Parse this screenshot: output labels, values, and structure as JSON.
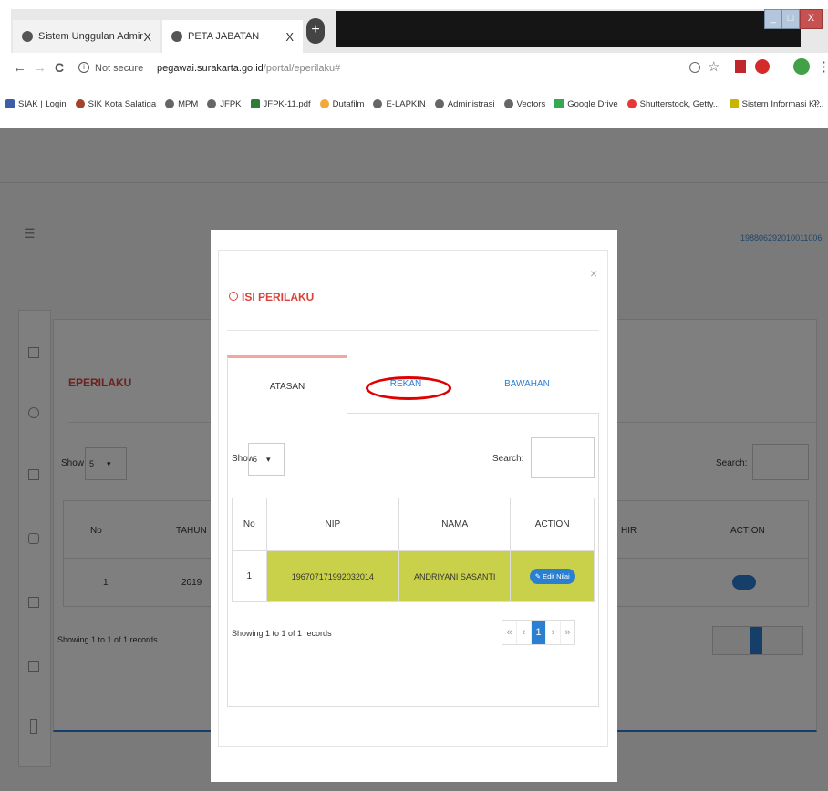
{
  "browser": {
    "tabs": [
      {
        "title": "Sistem Unggulan Administrasi Ke",
        "close": "X"
      },
      {
        "title": "PETA JABATAN",
        "close": "X"
      }
    ],
    "new_tab": "+",
    "window_buttons": [
      "_",
      "□",
      "X"
    ],
    "nav": {
      "back": "←",
      "forward": "→",
      "reload": "C"
    },
    "security": "Not secure",
    "url_host": "pegawai.surakarta.go.id",
    "url_path": "/portal/eperilaku#",
    "bookmarks": [
      "SIAK | Login",
      "SIK Kota Salatiga",
      "MPM",
      "JFPK",
      "JFPK-11.pdf",
      "Dutafilm",
      "E-LAPKIN",
      "Administrasi",
      "Vectors",
      "Google Drive",
      "Shutterstock, Getty...",
      "Sistem Informasi Ki..."
    ],
    "more_bookmarks": "»"
  },
  "page": {
    "user_nip": "198806292010011006",
    "section_title": "EPERILAKU",
    "show_label": "Show",
    "show_value": "5",
    "search_label": "Search:",
    "columns": [
      "No",
      "TAHUN",
      "HIR",
      "ACTION"
    ],
    "row": {
      "no": "1",
      "tahun": "2019"
    },
    "footer": "Showing 1 to 1 of 1 records"
  },
  "modal": {
    "close": "×",
    "title": "ISI PERILAKU",
    "tabs": [
      "ATASAN",
      "REKAN",
      "BAWAHAN"
    ],
    "show_label": "Show",
    "show_value": "5",
    "search_label": "Search:",
    "columns": [
      "No",
      "NIP",
      "NAMA",
      "ACTION"
    ],
    "rows": [
      {
        "no": "1",
        "nip": "196707171992032014",
        "nama": "ANDRIYANI SASANTI",
        "action": "Edit Nilai"
      }
    ],
    "footer": "Showing 1 to 1 of 1 records",
    "pagination": [
      "«",
      "‹",
      "1",
      "›",
      "»"
    ]
  },
  "colors": {
    "highlight_row": "#c9d14a",
    "accent_red": "#d9443a",
    "tab_active": "#f4a6a0",
    "primary": "#2a7fd0",
    "annotation": "#e00000"
  }
}
